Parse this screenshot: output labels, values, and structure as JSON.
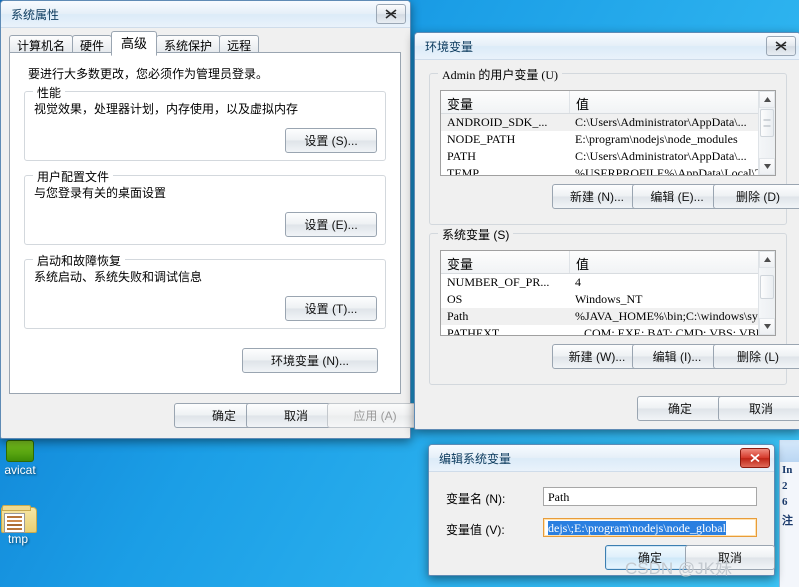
{
  "desktop": {
    "icons": [
      {
        "label": "avicat",
        "icon": "navicat-app-icon"
      },
      {
        "label": "tmp",
        "icon": "folder-icon"
      }
    ],
    "background_window": {
      "lines": [
        "In",
        "2",
        "6",
        "注"
      ]
    }
  },
  "system_properties": {
    "title": "系统属性",
    "close_label": "×",
    "tabs": [
      {
        "label": "计算机名",
        "active": false
      },
      {
        "label": "硬件",
        "active": false
      },
      {
        "label": "高级",
        "active": true
      },
      {
        "label": "系统保护",
        "active": false
      },
      {
        "label": "远程",
        "active": false
      }
    ],
    "notice": "要进行大多数更改，您必须作为管理员登录。",
    "groups": [
      {
        "legend": "性能",
        "desc": "视觉效果，处理器计划，内存使用，以及虚拟内存",
        "button": "设置 (S)..."
      },
      {
        "legend": "用户配置文件",
        "desc": "与您登录有关的桌面设置",
        "button": "设置 (E)..."
      },
      {
        "legend": "启动和故障恢复",
        "desc": "系统启动、系统失败和调试信息",
        "button": "设置 (T)..."
      }
    ],
    "env_button": "环境变量 (N)...",
    "ok": "确定",
    "cancel": "取消",
    "apply": "应用 (A)"
  },
  "environment_variables": {
    "title": "环境变量",
    "close_label": "×",
    "user_group": {
      "legend": "Admin 的用户变量 (U)",
      "columns": [
        "变量",
        "值"
      ],
      "rows": [
        {
          "name": "ANDROID_SDK_...",
          "value": "C:\\Users\\Administrator\\AppData\\...",
          "selected": true
        },
        {
          "name": "NODE_PATH",
          "value": "E:\\program\\nodejs\\node_modules",
          "selected": false
        },
        {
          "name": "PATH",
          "value": "C:\\Users\\Administrator\\AppData\\...",
          "selected": false
        },
        {
          "name": "TEMP",
          "value": "%USERPROFILE%\\AppData\\Local\\Temp",
          "selected": false
        }
      ],
      "buttons": {
        "new": "新建 (N)...",
        "edit": "编辑 (E)...",
        "delete": "删除 (D)"
      }
    },
    "system_group": {
      "legend": "系统变量 (S)",
      "columns": [
        "变量",
        "值"
      ],
      "rows": [
        {
          "name": "NUMBER_OF_PR...",
          "value": "4",
          "selected": false
        },
        {
          "name": "OS",
          "value": "Windows_NT",
          "selected": false
        },
        {
          "name": "Path",
          "value": "%JAVA_HOME%\\bin;C:\\windows\\syst...",
          "selected": true
        },
        {
          "name": "PATHEXT",
          "value": ".COM;.EXE;.BAT;.CMD;.VBS;.VBE;",
          "selected": false
        }
      ],
      "buttons": {
        "new": "新建 (W)...",
        "edit": "编辑 (I)...",
        "delete": "删除 (L)"
      }
    },
    "ok": "确定",
    "cancel": "取消"
  },
  "edit_system_variable": {
    "title": "编辑系统变量",
    "close_label": "×",
    "name_label": "变量名 (N):",
    "name_value": "Path",
    "value_label": "变量值 (V):",
    "value_value": "dejs\\;E:\\program\\nodejs\\node_global",
    "ok": "确定",
    "cancel": "取消"
  },
  "watermark": "CSDN @JK妹"
}
